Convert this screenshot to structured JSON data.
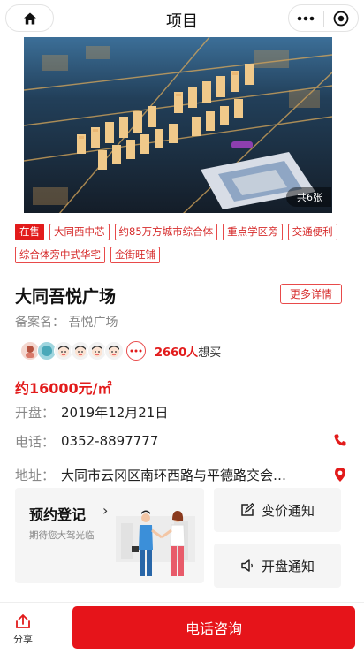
{
  "header": {
    "title": "项目"
  },
  "gallery": {
    "count_label": "共6张"
  },
  "tags": [
    "在售",
    "大同西中芯",
    "约85万方城市综合体",
    "重点学区旁",
    "交通便利",
    "综合体旁中式华宅",
    "金街旺铺"
  ],
  "project": {
    "name": "大同吾悦广场",
    "more_label": "更多详情",
    "record_label": "备案名：",
    "record_value": "吾悦广场",
    "want_count": "2660人",
    "want_suffix": "想买",
    "price": "约16000元/㎡"
  },
  "info": {
    "open_label": "开盘：",
    "open_value": "2019年12月21日",
    "phone_label": "电话：",
    "phone_value": "0352-8897777",
    "addr_label": "地址：",
    "addr_value": "大同市云冈区南环西路与平德路交会…"
  },
  "reserve": {
    "title": "预约登记",
    "subtitle": "期待您大驾光临"
  },
  "notices": {
    "price_change": "变价通知",
    "opening": "开盘通知"
  },
  "bottom": {
    "share_label": "分享",
    "call_label": "电话咨询"
  },
  "colors": {
    "accent": "#e6141a"
  }
}
